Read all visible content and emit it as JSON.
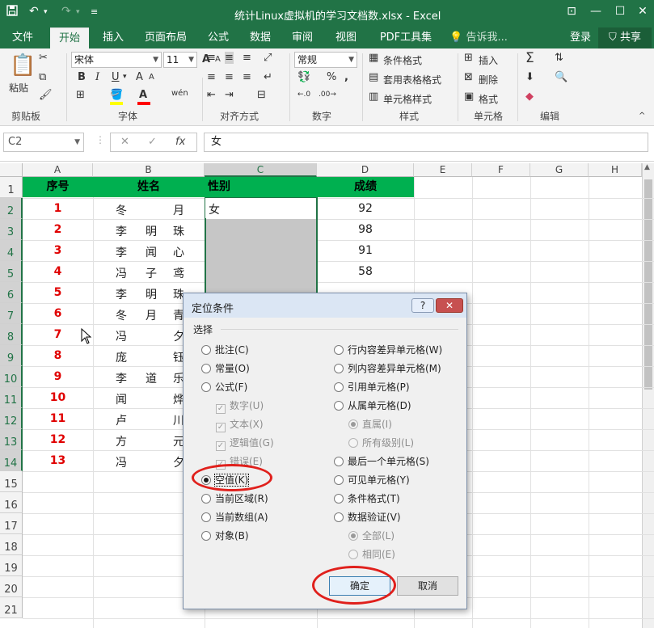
{
  "titlebar": {
    "title": "统计Linux虚拟机的学习文档数.xlsx - Excel",
    "save_icon": "save-icon",
    "undo_icon": "undo-icon",
    "redo_icon": "redo-icon"
  },
  "tabs": [
    "文件",
    "开始",
    "插入",
    "页面布局",
    "公式",
    "数据",
    "审阅",
    "视图",
    "PDF工具集"
  ],
  "tell_me": "告诉我...",
  "login": "登录",
  "share": "共享",
  "ribbon": {
    "paste": "粘贴",
    "clipboard": "剪贴板",
    "font_name": "宋体",
    "font_size": "11",
    "font": "字体",
    "align": "对齐方式",
    "number_format": "常规",
    "number": "数字",
    "cond_format": "条件格式",
    "table_format": "套用表格格式",
    "cell_style": "单元格样式",
    "styles": "样式",
    "insert": "插入",
    "delete": "删除",
    "format": "格式",
    "cells": "单元格",
    "edit": "编辑",
    "bold": "B",
    "italic": "I",
    "underline": "U",
    "grow_font": "A",
    "shrink_font": "A",
    "wen": "wén",
    "percent": "%",
    "comma": ",",
    "inc_decimal": ".00 .0",
    "dec_decimal": ".00 .0",
    "sigma": "Σ"
  },
  "formula_bar": {
    "name_box": "C2",
    "cancel": "✕",
    "enter": "✓",
    "fx": "fx",
    "content": "女"
  },
  "columns": [
    "A",
    "B",
    "C",
    "D",
    "E",
    "F",
    "G",
    "H"
  ],
  "rows": [
    "1",
    "2",
    "3",
    "4",
    "5",
    "6",
    "7",
    "8",
    "9",
    "10",
    "11",
    "12",
    "13",
    "14",
    "15",
    "16",
    "17",
    "18",
    "19",
    "20",
    "21"
  ],
  "table": {
    "headers": [
      "序号",
      "姓名",
      "性别",
      "成绩"
    ],
    "ids": [
      "1",
      "2",
      "3",
      "4",
      "5",
      "6",
      "7",
      "8",
      "9",
      "10",
      "11",
      "12",
      "13"
    ],
    "names": [
      [
        "冬",
        "",
        "月"
      ],
      [
        "李",
        "明",
        "珠"
      ],
      [
        "李",
        "闻",
        "心"
      ],
      [
        "冯",
        "子",
        "鸢"
      ],
      [
        "李",
        "明",
        "珠"
      ],
      [
        "冬",
        "月",
        "青"
      ],
      [
        "冯",
        "",
        "夕"
      ],
      [
        "庞",
        "",
        "钰"
      ],
      [
        "李",
        "道",
        "乐"
      ],
      [
        "闻",
        "",
        "烨"
      ],
      [
        "卢",
        "",
        "川"
      ],
      [
        "方",
        "",
        "元"
      ],
      [
        "冯",
        "",
        "夕"
      ]
    ],
    "c2_value": "女",
    "scores": [
      "92",
      "98",
      "91",
      "58"
    ]
  },
  "dialog": {
    "title": "定位条件",
    "help": "?",
    "close": "✕",
    "section": "选择",
    "left_options": [
      "批注(C)",
      "常量(O)",
      "公式(F)",
      "数字(U)",
      "文本(X)",
      "逻辑值(G)",
      "错误(E)",
      "空值(K)",
      "当前区域(R)",
      "当前数组(A)",
      "对象(B)"
    ],
    "right_options": [
      "行内容差异单元格(W)",
      "列内容差异单元格(M)",
      "引用单元格(P)",
      "从属单元格(D)",
      "直属(I)",
      "所有级别(L)",
      "最后一个单元格(S)",
      "可见单元格(Y)",
      "条件格式(T)",
      "数据验证(V)",
      "全部(L)",
      "相同(E)"
    ],
    "ok": "确定",
    "cancel": "取消"
  }
}
